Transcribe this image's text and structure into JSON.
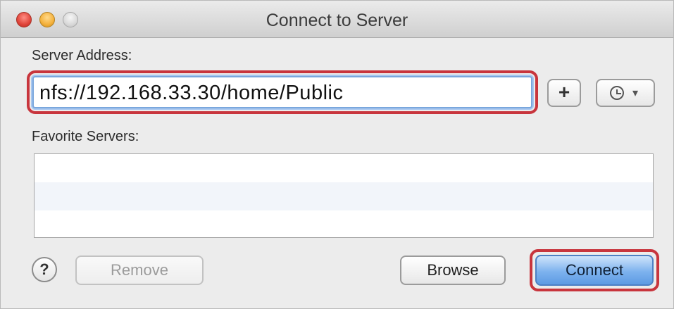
{
  "window": {
    "title": "Connect to Server"
  },
  "server_address": {
    "label": "Server Address:",
    "value": "nfs://192.168.33.30/home/Public",
    "add_label": "+",
    "history_icon": "clock-icon",
    "history_caret": "▾"
  },
  "favorites": {
    "label": "Favorite Servers:",
    "rows": [
      "",
      "",
      ""
    ]
  },
  "footer": {
    "help_label": "?",
    "remove_label": "Remove",
    "browse_label": "Browse",
    "connect_label": "Connect"
  },
  "colors": {
    "highlight": "#c8353d",
    "focus_ring": "#7aa7dd",
    "default_button": "#7db2ee"
  }
}
